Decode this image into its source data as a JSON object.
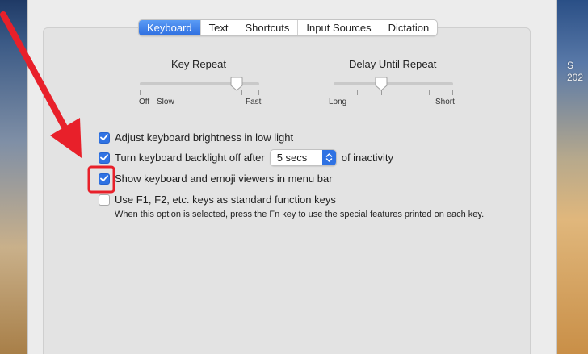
{
  "desktop": {
    "partial_text_1": "S",
    "partial_text_2": "202"
  },
  "tabs": [
    {
      "label": "Keyboard",
      "selected": true
    },
    {
      "label": "Text",
      "selected": false
    },
    {
      "label": "Shortcuts",
      "selected": false
    },
    {
      "label": "Input Sources",
      "selected": false
    },
    {
      "label": "Dictation",
      "selected": false
    }
  ],
  "key_repeat": {
    "title": "Key Repeat",
    "min_label": "Off",
    "slow_label": "Slow",
    "max_label": "Fast",
    "value_fraction": 0.81
  },
  "delay_until_repeat": {
    "title": "Delay Until Repeat",
    "min_label": "Long",
    "max_label": "Short",
    "value_fraction": 0.4
  },
  "options": {
    "brightness": {
      "label": "Adjust keyboard brightness in low light",
      "checked": true
    },
    "backlight": {
      "label_before": "Turn keyboard backlight off after",
      "popup_value": "5 secs",
      "label_after": "of inactivity",
      "checked": true
    },
    "viewers": {
      "label": "Show keyboard and emoji viewers in menu bar",
      "checked": true
    },
    "function_keys": {
      "label": "Use F1, F2, etc. keys as standard function keys",
      "checked": false,
      "hint": "When this option is selected, press the Fn key to use the special features printed on each key."
    }
  },
  "annotation": {
    "color": "#e8202a",
    "shapes": [
      "arrow",
      "highlight-box"
    ]
  },
  "colors": {
    "accent": "#2f72e3",
    "annotation": "#e8202a"
  }
}
